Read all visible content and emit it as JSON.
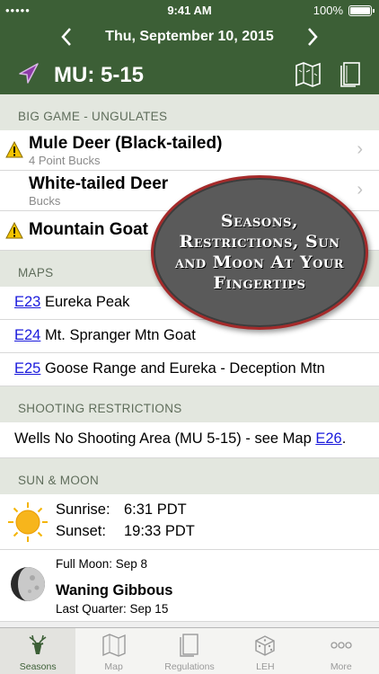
{
  "status": {
    "carrier": "•••••",
    "time": "9:41 AM",
    "battery": "100%"
  },
  "header": {
    "date": "Thu, September 10, 2015",
    "title": "MU: 5-15"
  },
  "sections": {
    "big_game": "BIG GAME - UNGULATES",
    "maps": "MAPS",
    "shooting": "SHOOTING RESTRICTIONS",
    "sun_moon": "SUN & MOON"
  },
  "game": [
    {
      "name": "Mule Deer (Black-tailed)",
      "sub": "4 Point Bucks",
      "warning": true
    },
    {
      "name": "White-tailed Deer",
      "sub": "Bucks",
      "warning": false
    },
    {
      "name": "Mountain Goat",
      "sub": "",
      "warning": true
    }
  ],
  "maps": [
    {
      "code": "E23",
      "name": "Eureka Peak"
    },
    {
      "code": "E24",
      "name": "Mt. Spranger Mtn Goat"
    },
    {
      "code": "E25",
      "name": "Goose Range and Eureka - Deception Mtn"
    }
  ],
  "shooting": {
    "text": "Wells No Shooting Area (MU 5-15) - see Map ",
    "link": "E26",
    "suffix": "."
  },
  "sun": {
    "sunrise_label": "Sunrise:",
    "sunrise": "6:31 PDT",
    "sunset_label": "Sunset:",
    "sunset": "19:33 PDT"
  },
  "moon": {
    "full": "Full Moon: Sep 8",
    "phase": "Waning Gibbous",
    "quarter": "Last Quarter: Sep 15"
  },
  "promo": "Seasons, Restrictions, Sun and Moon At Your Fingertips",
  "tabs": [
    {
      "label": "Seasons",
      "icon": "deer-icon"
    },
    {
      "label": "Map",
      "icon": "map-icon"
    },
    {
      "label": "Regulations",
      "icon": "book-icon"
    },
    {
      "label": "LEH",
      "icon": "dice-icon"
    },
    {
      "label": "More",
      "icon": "more-icon"
    }
  ],
  "colors": {
    "header": "#3c5f36",
    "section": "#e3e7df",
    "link": "#1a1adc",
    "warning": "#f2c300",
    "promo_border": "#a52a2a"
  }
}
